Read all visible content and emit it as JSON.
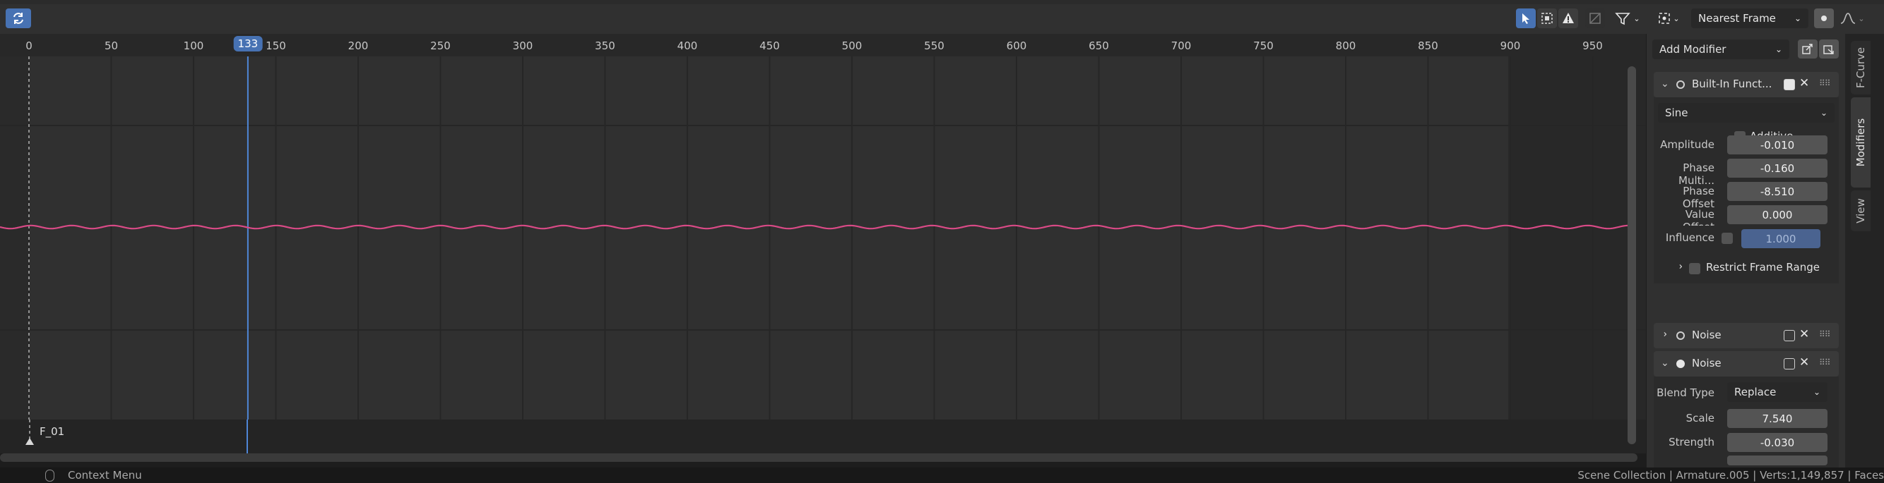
{
  "header": {
    "snap_mode": "Nearest Frame",
    "sync_icon": "sync-icon",
    "select_icon": "cursor-select-icon",
    "box_icon": "box-select-icon",
    "warning_icon": "warning-icon",
    "filter_icon": "filter-icon"
  },
  "ruler": {
    "ticks": [
      "0",
      "50",
      "100",
      "150",
      "200",
      "250",
      "300",
      "350",
      "400",
      "450",
      "500",
      "550",
      "600",
      "650",
      "700",
      "750",
      "800",
      "850",
      "900",
      "950"
    ],
    "current_frame": "133"
  },
  "curve": {
    "color": "#d94a86",
    "type": "sine"
  },
  "channel": {
    "label": "F_01"
  },
  "sidebar": {
    "add_modifier": "Add Modifier",
    "builtin": {
      "title": "Built-In Funct...",
      "function": "Sine",
      "additive_label": "Additive",
      "fields": [
        {
          "label": "Amplitude",
          "value": "-0.010"
        },
        {
          "label": "Phase Multi...",
          "value": "-0.160"
        },
        {
          "label": "Phase Offset",
          "value": "-8.510"
        },
        {
          "label": "Value Offset",
          "value": "0.000"
        }
      ],
      "influence_label": "Influence",
      "influence_value": "1.000",
      "restrict_label": "Restrict Frame Range"
    },
    "noise1": {
      "title": "Noise"
    },
    "noise2": {
      "title": "Noise",
      "blend_label": "Blend Type",
      "blend_value": "Replace",
      "scale_label": "Scale",
      "scale_value": "7.540",
      "strength_label": "Strength",
      "strength_value": "-0.030"
    }
  },
  "tabs": [
    "F-Curve",
    "Modifiers",
    "View"
  ],
  "status": {
    "context_menu": "Context Menu",
    "scene_info": "Scene Collection | Armature.005 | Verts:1,149,857 | Faces"
  }
}
